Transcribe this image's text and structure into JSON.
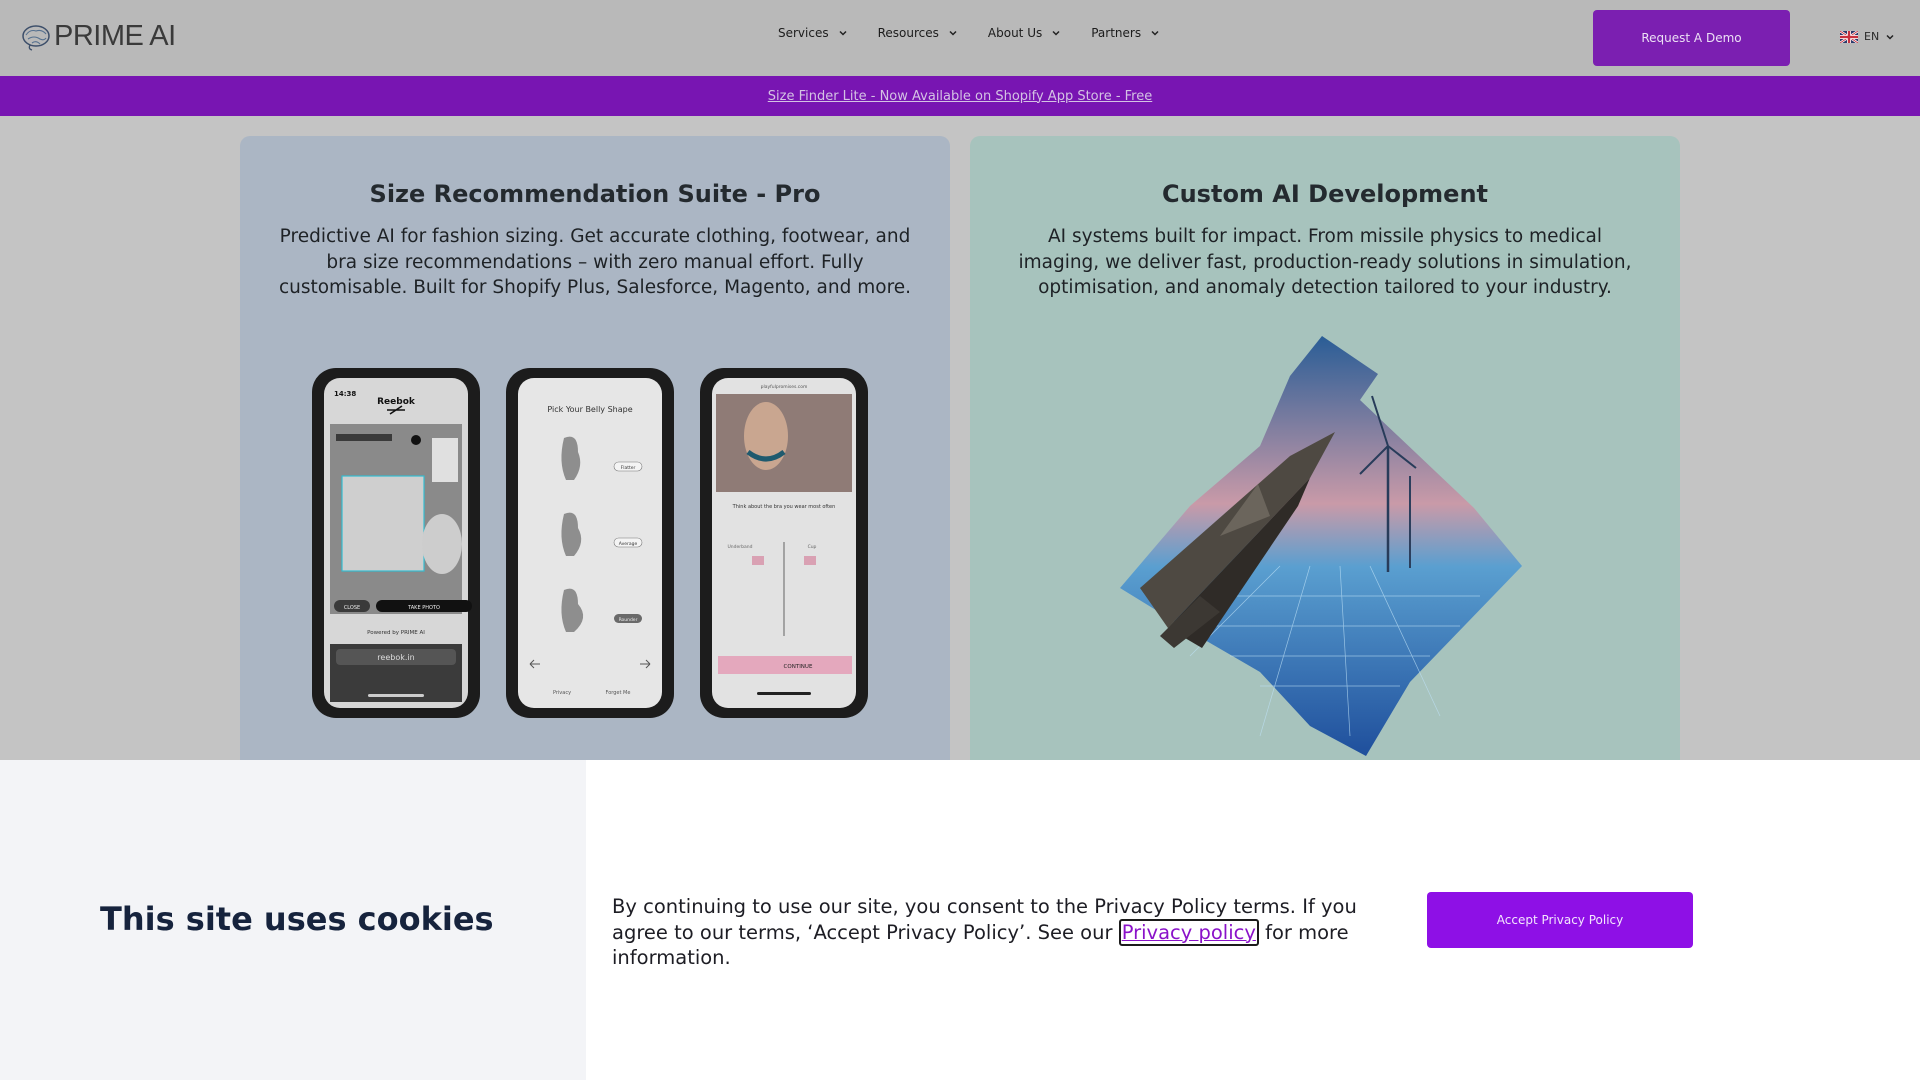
{
  "header": {
    "logo_text": "PRIME AI",
    "nav": [
      {
        "label": "Services"
      },
      {
        "label": "Resources"
      },
      {
        "label": "About Us"
      },
      {
        "label": "Partners"
      }
    ],
    "demo_button": "Request A Demo",
    "language": "EN"
  },
  "banner": {
    "text": "Size Finder Lite - Now Available on Shopify App Store - Free"
  },
  "cards": [
    {
      "title": "Size Recommendation Suite - Pro",
      "description": "Predictive AI for fashion sizing. Get accurate clothing, footwear, and bra size recommendations – with zero manual effort. Fully customisable. Built for Shopify Plus, Salesforce, Magento, and more."
    },
    {
      "title": "Custom AI Development",
      "description": "AI systems built for impact. From missile physics to medical imaging, we deliver fast, production-ready solutions in simulation, optimisation, and anomaly detection tailored to your industry."
    }
  ],
  "phones": {
    "phone1": {
      "time": "14:38",
      "brand": "Reebok",
      "close": "CLOSE",
      "take_photo": "TAKE PHOTO",
      "powered": "Powered by PRIME AI",
      "url": "reebok.in"
    },
    "phone2": {
      "heading": "Pick Your Belly Shape",
      "options": [
        "Flatter",
        "Average",
        "Rounder"
      ],
      "privacy": "Privacy",
      "forget": "Forget Me"
    },
    "phone3": {
      "url": "playfulpromises.com",
      "prompt": "Think about the bra you wear most often",
      "underband": "Underband",
      "cup": "Cup",
      "continue": "CONTINUE"
    }
  },
  "cookie": {
    "title": "This site uses cookies",
    "text_before": "By continuing to use our site, you consent to the Privacy Policy terms. If you agree to our terms, ‘Accept Privacy Policy’. See our ",
    "link": "Privacy policy",
    "text_after": " for more information.",
    "accept_button": "Accept Privacy Policy"
  },
  "colors": {
    "purple_banner": "#7815b2",
    "demo_button": "#7b1fb1",
    "accept_button": "#8e10e6"
  }
}
